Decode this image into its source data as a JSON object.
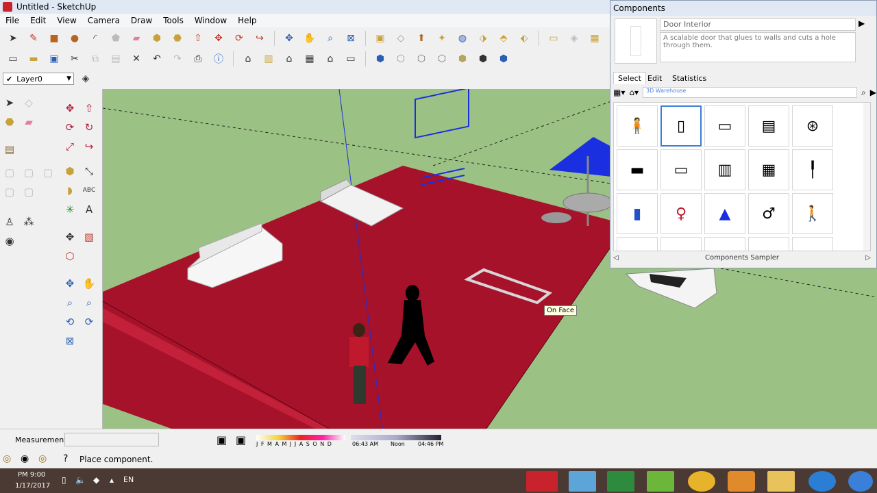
{
  "window": {
    "title": "Untitled - SketchUp"
  },
  "menu": [
    "File",
    "Edit",
    "View",
    "Camera",
    "Draw",
    "Tools",
    "Window",
    "Help"
  ],
  "layer": {
    "name": "Layer0"
  },
  "tooltip": "On Face",
  "components": {
    "title": "Components",
    "name": "Door Interior",
    "description": "A scalable door that glues to walls and cuts a hole through them.",
    "tabs": [
      "Select",
      "Edit",
      "Statistics"
    ],
    "search_hint": "3D Warehouse",
    "collection": "Components Sampler"
  },
  "status": {
    "measurements_label": "Measurements",
    "message": "Place component."
  },
  "shadow": {
    "months": "J F M A M J J A S O N D",
    "time_start": "06:43 AM",
    "time_mid": "Noon",
    "time_end": "04:46 PM"
  },
  "taskbar": {
    "time": "PM 9:00",
    "date": "1/17/2017",
    "lang": "EN"
  },
  "colors": {
    "ground": "#9cc184",
    "floor": "#a7122b",
    "selection": "#1a2fe0"
  }
}
